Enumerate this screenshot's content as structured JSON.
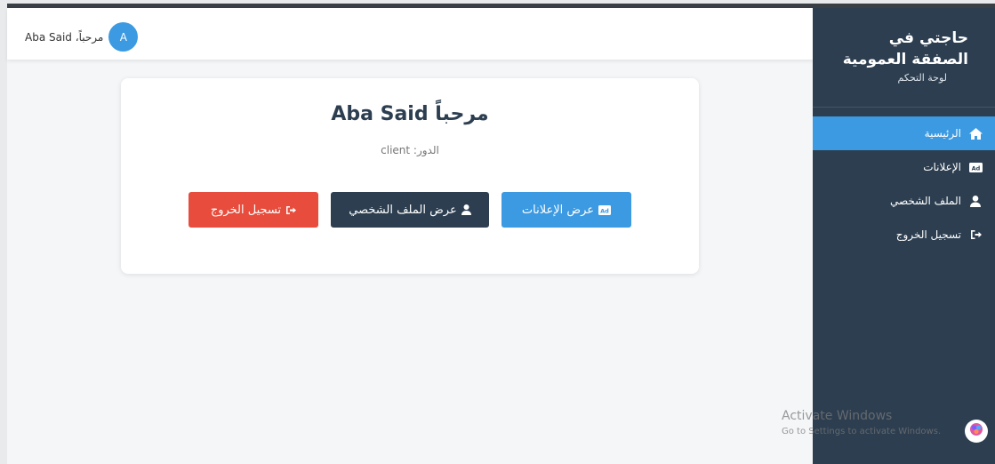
{
  "header": {
    "user_greeting": "مرحباً، Aba Said",
    "avatar_letter": "A"
  },
  "card": {
    "welcome": "مرحباً Aba Said",
    "role_line": "الدور: client",
    "buttons": {
      "logout": "تسجيل الخروج",
      "profile": "عرض الملف الشخصي",
      "ads": "عرض الإعلانات"
    }
  },
  "sidebar": {
    "title": "حاجتي في الصفقة العمومية",
    "subtitle": "لوحة التحكم",
    "items": [
      {
        "label": "الرئيسية",
        "icon": "home-icon",
        "active": true
      },
      {
        "label": "الإعلانات",
        "icon": "ad-icon",
        "active": false
      },
      {
        "label": "الملف الشخصي",
        "icon": "user-icon",
        "active": false
      },
      {
        "label": "تسجيل الخروج",
        "icon": "sign-out-icon",
        "active": false
      }
    ]
  },
  "watermark": {
    "title": "Activate Windows",
    "subtitle": "Go to Settings to activate Windows."
  },
  "colors": {
    "sidebar_bg": "#2c3e50",
    "accent_blue": "#3b9ae1",
    "danger_red": "#e74c3c",
    "dark_button": "#2c3e50"
  }
}
